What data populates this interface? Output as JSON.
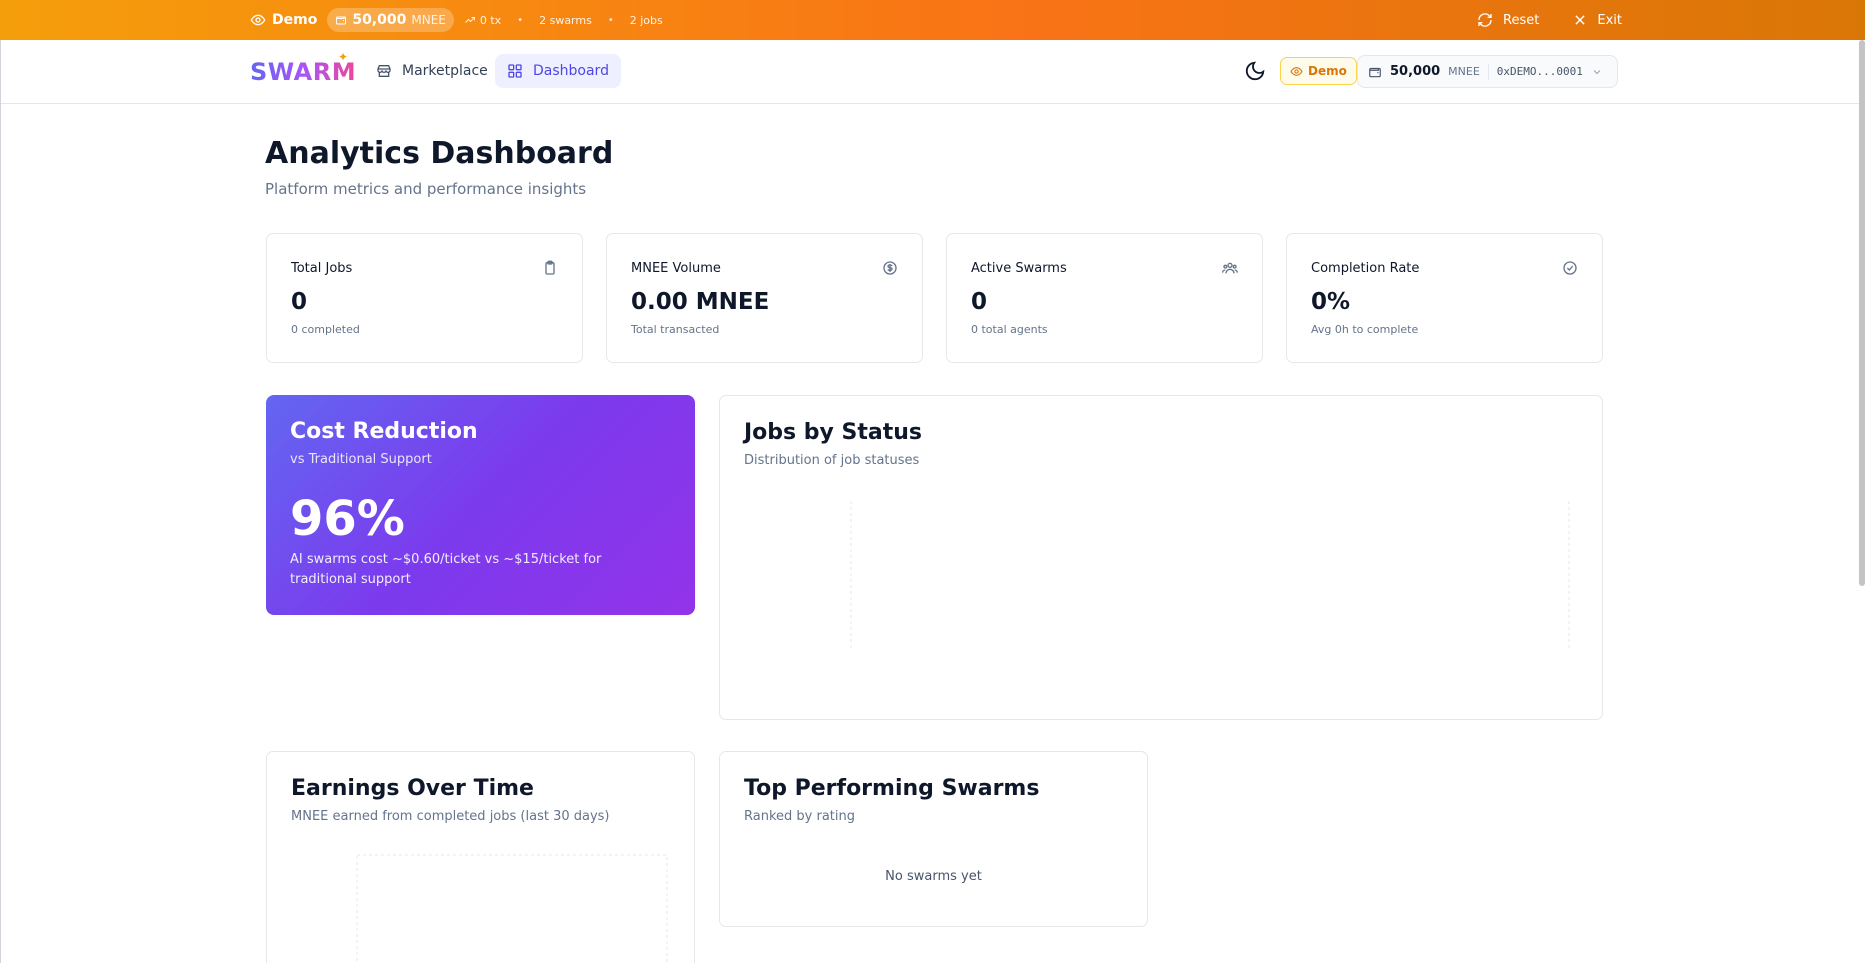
{
  "demo_bar": {
    "demo_label": "Demo",
    "balance": "50,000",
    "balance_unit": "MNEE",
    "tx": "0 tx",
    "swarms": "2 swarms",
    "jobs": "2 jobs",
    "reset_label": "Reset",
    "exit_label": "Exit"
  },
  "nav": {
    "logo": "SWARM",
    "links": [
      {
        "label": "Marketplace"
      },
      {
        "label": "Dashboard"
      }
    ],
    "demo_badge": "Demo",
    "wallet": {
      "balance": "50,000",
      "unit": "MNEE",
      "address": "0xDEMO...0001"
    }
  },
  "page": {
    "title": "Analytics Dashboard",
    "subtitle": "Platform metrics and performance insights"
  },
  "stats": [
    {
      "label": "Total Jobs",
      "value": "0",
      "note": "0 completed",
      "icon": "clipboard-icon"
    },
    {
      "label": "MNEE Volume",
      "value": "0.00 MNEE",
      "note": "Total transacted",
      "icon": "dollar-circle-icon"
    },
    {
      "label": "Active Swarms",
      "value": "0",
      "note": "0 total agents",
      "icon": "users-icon"
    },
    {
      "label": "Completion Rate",
      "value": "0%",
      "note": "Avg 0h to complete",
      "icon": "check-circle-icon"
    }
  ],
  "cost": {
    "title": "Cost Reduction",
    "subtitle": "vs Traditional Support",
    "value": "96%",
    "description": "AI swarms cost ~$0.60/ticket vs ~$15/ticket for traditional support"
  },
  "jobs_status": {
    "title": "Jobs by Status",
    "subtitle": "Distribution of job statuses"
  },
  "earnings": {
    "title": "Earnings Over Time",
    "subtitle": "MNEE earned from completed jobs (last 30 days)"
  },
  "top_swarms": {
    "title": "Top Performing Swarms",
    "subtitle": "Ranked by rating",
    "empty": "No swarms yet"
  },
  "colors": {
    "accent": "#4f46e5",
    "demo_orange": "#f97316",
    "cost_gradient_start": "#6366f1",
    "cost_gradient_end": "#9333ea"
  }
}
